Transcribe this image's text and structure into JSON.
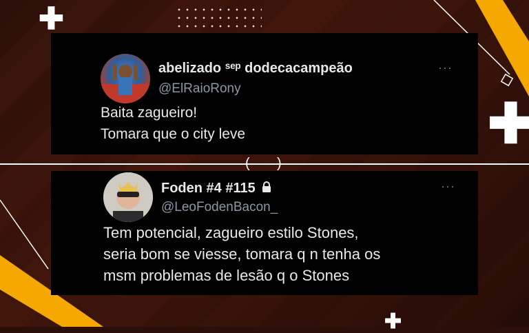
{
  "tweets": [
    {
      "name": "abelizado ˢᵉᵖ dodecacampeão",
      "handle": "@ElRaioRony",
      "lines": [
        "Baita zagueiro!",
        "Tomara que o city leve"
      ],
      "more": "···"
    },
    {
      "name": "Foden #4 #115",
      "handle": "@LeoFodenBacon_",
      "lines": [
        "Tem potencial, zagueiro estilo Stones,",
        "seria bom se viesse, tomara q n tenha os",
        "msm problemas de lesão q o Stones"
      ],
      "more": "···"
    }
  ],
  "divider": {
    "left_paren": "(",
    "right_paren": ")"
  },
  "colors": {
    "accent": "#f5a800",
    "card_bg": "#000000",
    "handle": "#8b98a5",
    "text": "#e7e9ea"
  },
  "icons": {
    "lock": "lock-icon",
    "more": "more-icon"
  }
}
